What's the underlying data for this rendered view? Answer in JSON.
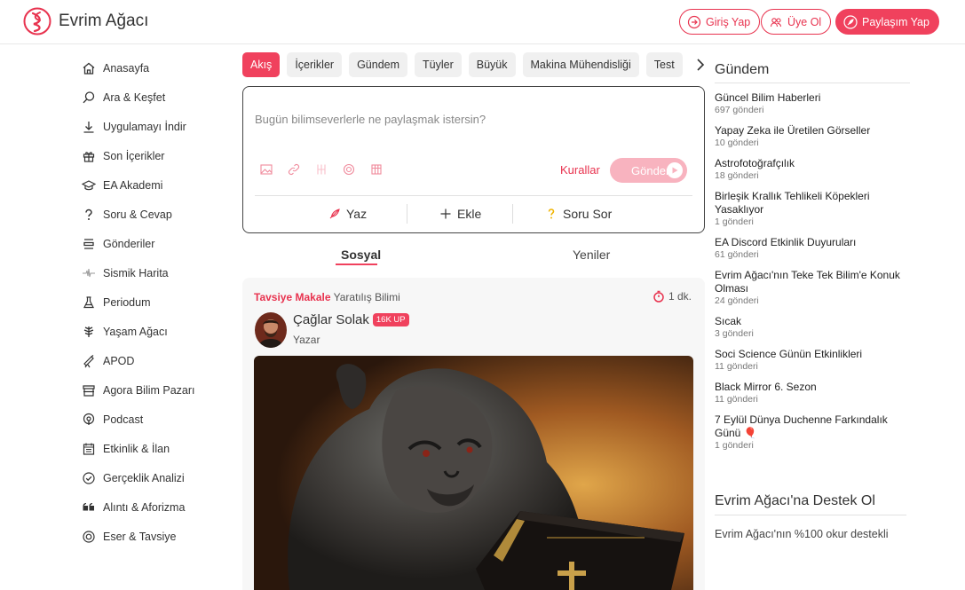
{
  "header": {
    "brand": "Evrim Ağacı",
    "login_label": "Giriş Yap",
    "signup_label": "Üye Ol",
    "share_label": "Paylaşım Yap"
  },
  "sidebar": {
    "items": [
      {
        "label": "Anasayfa",
        "icon": "home-icon"
      },
      {
        "label": "Ara & Keşfet",
        "icon": "search-icon"
      },
      {
        "label": "Uygulamayı İndir",
        "icon": "download-icon"
      },
      {
        "label": "Son İçerikler",
        "icon": "gift-icon"
      },
      {
        "label": "EA Akademi",
        "icon": "academy-icon"
      },
      {
        "label": "Soru & Cevap",
        "icon": "question-icon"
      },
      {
        "label": "Gönderiler",
        "icon": "posts-icon"
      },
      {
        "label": "Sismik Harita",
        "icon": "seismic-icon"
      },
      {
        "label": "Periodum",
        "icon": "flask-icon"
      },
      {
        "label": "Yaşam Ağacı",
        "icon": "tree-icon"
      },
      {
        "label": "APOD",
        "icon": "telescope-icon"
      },
      {
        "label": "Agora Bilim Pazarı",
        "icon": "store-icon"
      },
      {
        "label": "Podcast",
        "icon": "podcast-icon"
      },
      {
        "label": "Etkinlik & İlan",
        "icon": "calendar-icon"
      },
      {
        "label": "Gerçeklik Analizi",
        "icon": "check-circle-icon"
      },
      {
        "label": "Alıntı & Aforizma",
        "icon": "quote-icon"
      },
      {
        "label": "Eser & Tavsiye",
        "icon": "recommend-icon"
      }
    ]
  },
  "tabs": [
    "Akış",
    "İçerikler",
    "Gündem",
    "Tüyler",
    "Büyük",
    "Makina Mühendisliği",
    "Test"
  ],
  "compose": {
    "placeholder": "Bugün bilimseverlerle ne paylaşmak istersin?",
    "rules_label": "Kurallar",
    "send_label": "Gönder",
    "write_label": "Yaz",
    "add_label": "Ekle",
    "ask_label": "Soru Sor"
  },
  "feed": {
    "social_label": "Sosyal",
    "new_label": "Yeniler"
  },
  "post": {
    "category_highlight": "Tavsiye Makale",
    "category": "Yaratılış Bilimi",
    "read_time": "1 dk.",
    "author": "Çağlar Solak",
    "badge": "16K UP",
    "role": "Yazar"
  },
  "trending": {
    "title": "Gündem",
    "items": [
      {
        "title": "Güncel Bilim Haberleri",
        "count": "697 gönderi"
      },
      {
        "title": "Yapay Zeka ile Üretilen Görseller",
        "count": "10 gönderi"
      },
      {
        "title": "Astrofotoğrafçılık",
        "count": "18 gönderi"
      },
      {
        "title": "Birleşik Krallık Tehlikeli Köpekleri Yasaklıyor",
        "count": "1 gönderi"
      },
      {
        "title": "EA Discord Etkinlik Duyuruları",
        "count": "61 gönderi"
      },
      {
        "title": "Evrim Ağacı'nın Teke Tek Bilim'e Konuk Olması",
        "count": "24 gönderi"
      },
      {
        "title": "Sıcak",
        "count": "3 gönderi"
      },
      {
        "title": "Soci Science Günün Etkinlikleri",
        "count": "11 gönderi"
      },
      {
        "title": "Black Mirror 6. Sezon",
        "count": "11 gönderi"
      },
      {
        "title": "7 Eylül Dünya Duchenne Farkındalık Günü 🎈",
        "count": "1 gönderi"
      }
    ]
  },
  "support": {
    "title": "Evrim Ağacı'na Destek Ol",
    "text": "Evrim Ağacı'nın %100 okur destekli"
  },
  "colors": {
    "accent": "#f0415d",
    "accent_light": "#f8b3bf"
  }
}
